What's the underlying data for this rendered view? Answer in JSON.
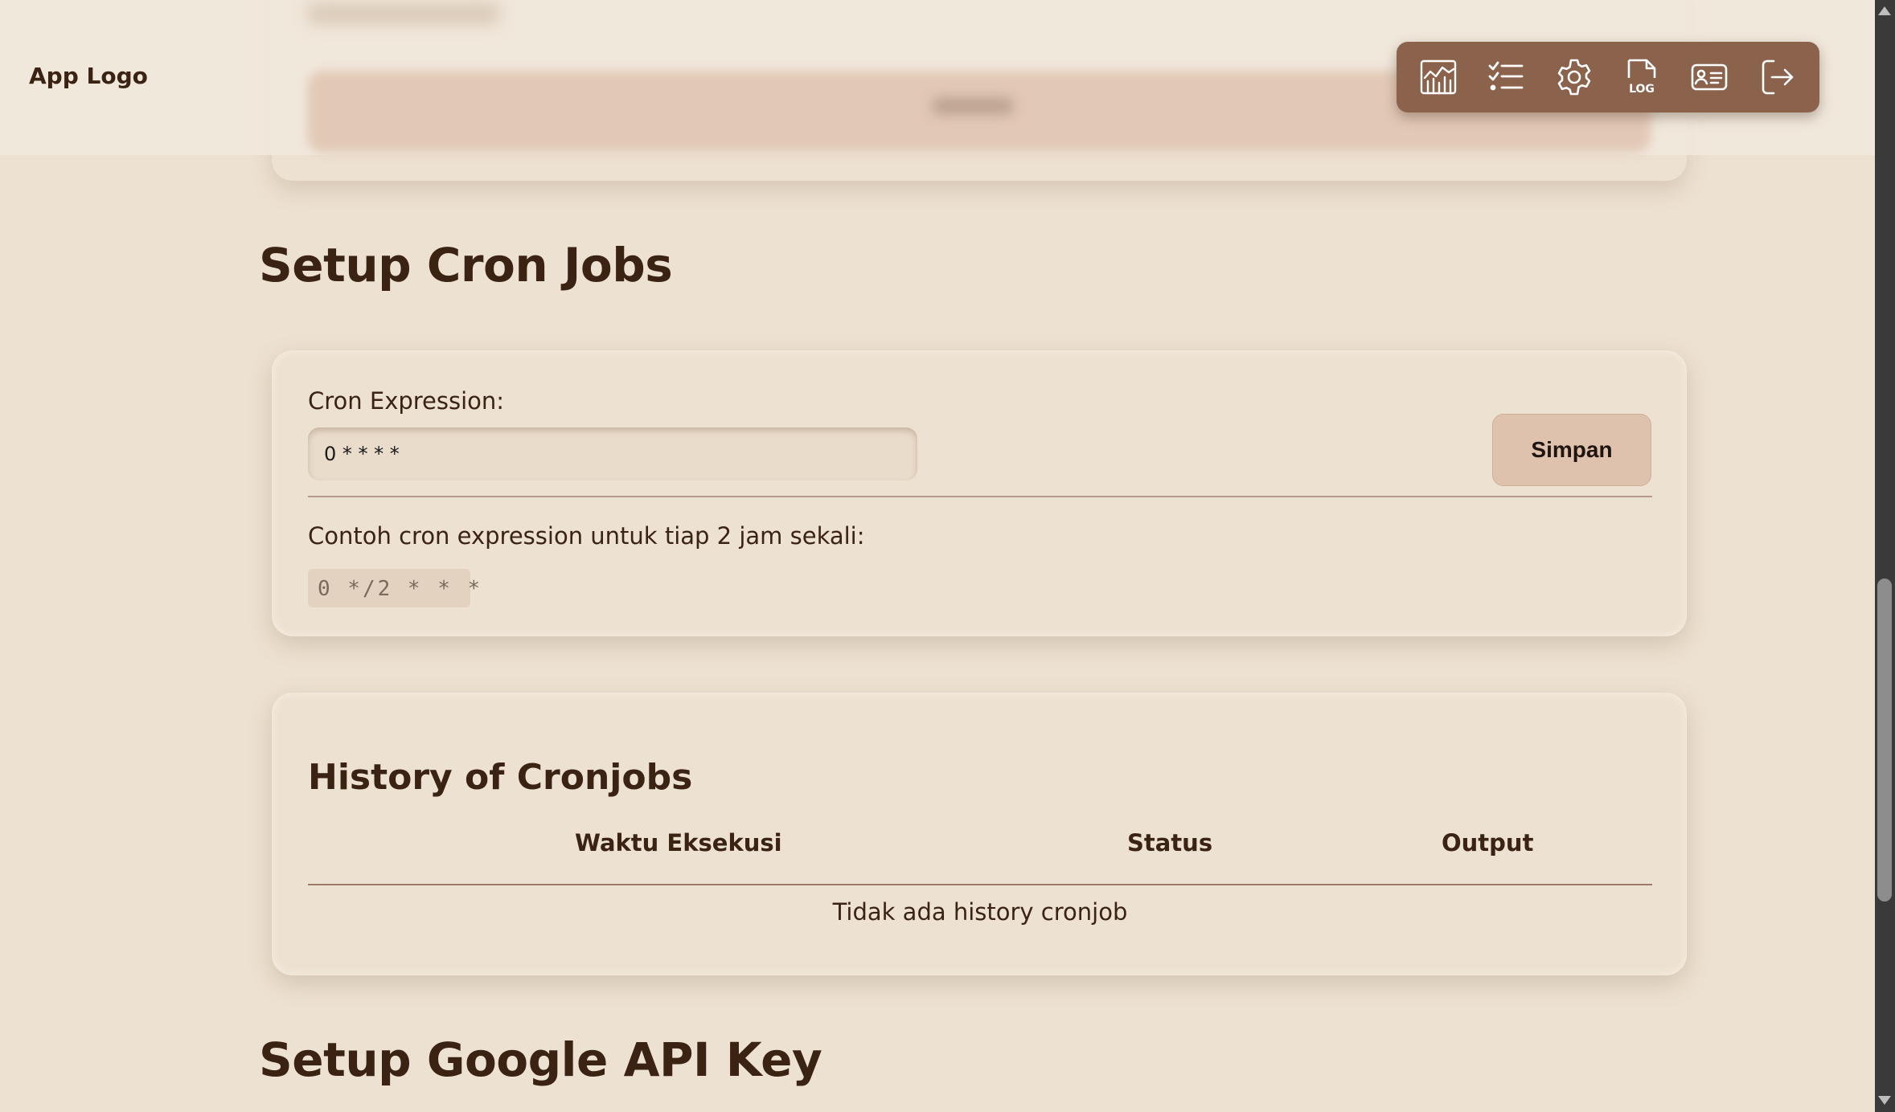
{
  "header": {
    "logo": "App Logo"
  },
  "nav": {
    "items": [
      {
        "icon": "chart-icon"
      },
      {
        "icon": "checklist-icon"
      },
      {
        "icon": "gear-icon"
      },
      {
        "icon": "log-file-icon",
        "label": "LOG"
      },
      {
        "icon": "id-card-icon"
      },
      {
        "icon": "logout-icon"
      }
    ],
    "background": "#8b624b"
  },
  "cron": {
    "title": "Setup Cron Jobs",
    "label": "Cron Expression:",
    "value": "0 * * * *",
    "save_label": "Simpan",
    "hint": "Contoh cron expression untuk tiap 2 jam sekali:",
    "example": "0 */2 * * *"
  },
  "history": {
    "title": "History of Cronjobs",
    "columns": [
      "Waktu Eksekusi",
      "Status",
      "Output"
    ],
    "empty_text": "Tidak ada history cronjob"
  },
  "google": {
    "title": "Setup Google API Key"
  },
  "colors": {
    "background": "#ede1d1",
    "text": "#3b2314",
    "button": "#dfc2ae"
  }
}
